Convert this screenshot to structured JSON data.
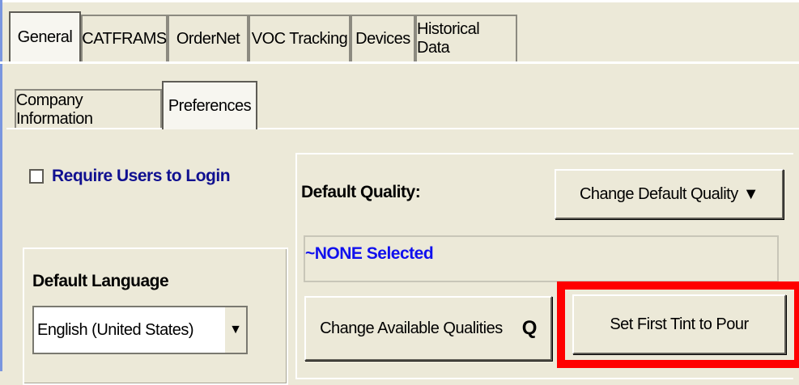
{
  "main_tabs": [
    "General",
    "CATFRAMS",
    "OrderNet",
    "VOC Tracking",
    "Devices",
    "Historical Data"
  ],
  "sub_tabs": [
    "Company Information",
    "Preferences"
  ],
  "require_login": {
    "label": "Require Users to Login",
    "checked": false
  },
  "default_language": {
    "label": "Default Language",
    "value": "English (United States)"
  },
  "default_quality": {
    "label": "Default Quality:",
    "change_button": "Change Default Quality",
    "selected": "~NONE Selected"
  },
  "buttons": {
    "change_available": "Change Available Qualities",
    "set_first_tint": "Set First Tint to Pour"
  },
  "colors": {
    "highlight": "#ff0000",
    "link_blue": "#1010ee",
    "label_navy": "#101090"
  }
}
